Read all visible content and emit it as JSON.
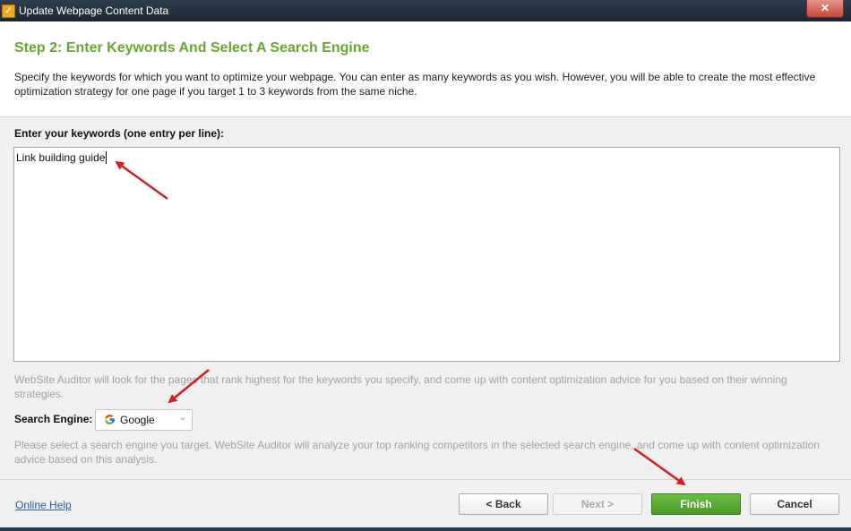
{
  "window": {
    "title": "Update Webpage Content Data",
    "close_label": "✕"
  },
  "header": {
    "step_title": "Step 2: Enter Keywords And Select A Search Engine",
    "description": "Specify the keywords for which you want to optimize your webpage. You can enter as many keywords as you wish. However, you will be able to create the most effective optimization strategy for one page if you target 1 to 3 keywords from the same niche."
  },
  "keywords": {
    "label": "Enter your keywords (one entry per line):",
    "value": "Link building guide"
  },
  "hint_rank": "WebSite Auditor will look for the pages that rank highest for the keywords you specify, and come up with content optimization advice for you based on their winning strategies.",
  "search_engine": {
    "label": "Search Engine:",
    "selected": "Google",
    "icon": "google-g-icon"
  },
  "hint_engine": "Please select a search engine you target. WebSite Auditor will analyze your top ranking competitors in the selected search engine, and come up with content optimization advice based on this analysis.",
  "footer": {
    "help_link": "Online Help",
    "back_label": "< Back",
    "next_label": "Next >",
    "finish_label": "Finish",
    "cancel_label": "Cancel"
  },
  "colors": {
    "accent_green": "#66a82f",
    "finish_green": "#4a9a26",
    "annotation_red": "#d32020",
    "link_blue": "#2a5ca8"
  }
}
